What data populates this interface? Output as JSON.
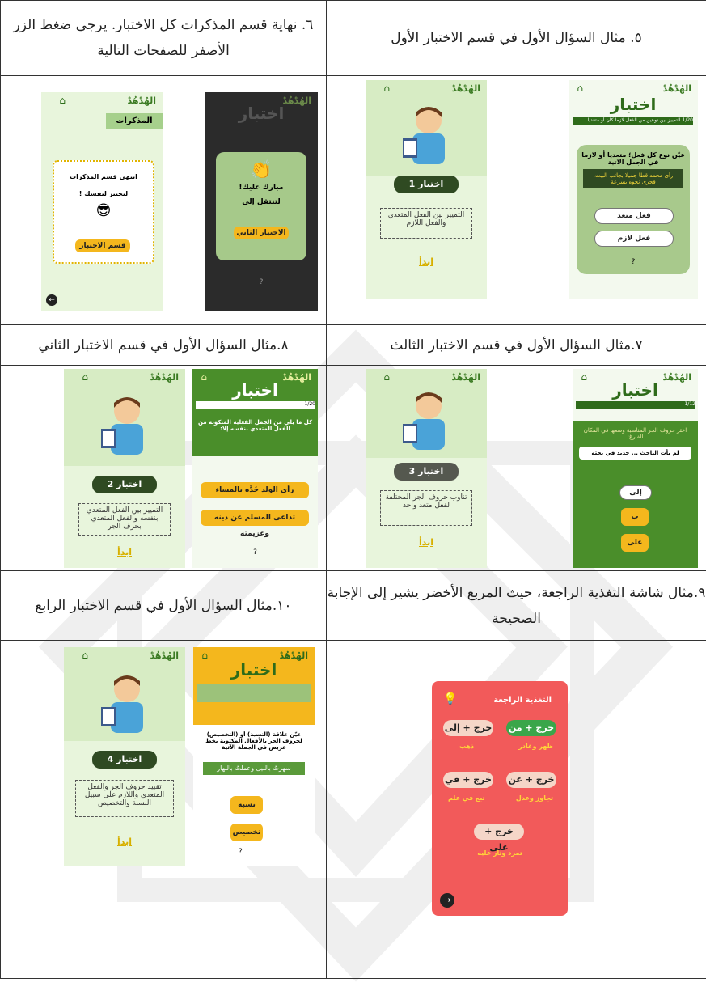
{
  "captions": {
    "c5": "٥. مثال السؤال الأول في قسم الاختبار الأول",
    "c6": "٦. نهاية قسم المذكرات كل الاختبار. يرجى ضغط الزر الأصفر للصفحات التالية",
    "c7": "٧.مثال السؤال الأول في قسم الاختبار الثالث",
    "c8": "٨.مثال السؤال الأول في قسم الاختبار الثاني",
    "c9": "٩.مثال شاشة التغذية الراجعة، حيث المربع الأخضر يشير إلى الإجابة الصحيحة",
    "c10": "١٠.مثال السؤال الأول في قسم الاختبار الرابع"
  },
  "app": {
    "brand": "الهُدْهُدْ",
    "quiz_title": "اختبار",
    "start": "ابدأ",
    "help": "?",
    "counter1": "1/20",
    "counter3": "1/12"
  },
  "s5": {
    "quiz_label": "اختبار 1",
    "desc": "التمييز بين الفعل المتعدي والفعل اللازم",
    "question_strip": "التمييز بين نوعين من الفعل لازما كان أو متعديا",
    "question": "عيّن نوع كل فعل؛ متعديا أو لازما في الجمل الآتية",
    "sentence": "رأى محمد قطا جميلا بجانب البيت، فجرى نحوه بسرعة",
    "opt1": "فعل متعد",
    "opt2": "فعل لازم"
  },
  "s6": {
    "notes_header": "المذكرات",
    "end_title": "انتهى قسم المذكرات",
    "end_sub": "لتختبر لنفسك !",
    "end_btn": "قسم الاختبار",
    "congrats": "مبارك عليك!",
    "go_to": "لتنتقل إلى",
    "next_btn": "الاختبار الثاني"
  },
  "s7": {
    "quiz_label": "اختبار 3",
    "desc": "تناوب حروف الجر المختلفة لفعل متعد واحد",
    "question": "اختر حروف الجر المناسبة وضعها في المكان الفارغ:",
    "sentence": "لم يأت الباحث ... جديد في بحثه",
    "opt_top": "إلى",
    "opt_a": "ب",
    "opt_b": "على"
  },
  "s8": {
    "quiz_label": "اختبار 2",
    "desc": "التمييز بين الفعل المتعدي بنفسه والفعل المتعدي بحرف الجر",
    "question": "كل ما يلي من الجمل الفعلية المتكونة من الفعل المتعدي بنفسه إلا:",
    "opt1": "رأى الولد خَدَّه بالمساء",
    "opt2": "تداعى المسلم عن دينه وعزيمته"
  },
  "s9": {
    "title": "التغذية الراجعة",
    "c1": "خرج + من",
    "c2": "خرج + إلى",
    "l1": "ظهر وغادر",
    "l2": "ذهب",
    "c3": "خرج + عن",
    "c4": "خرج + في",
    "l3": "تجاوز وعدل",
    "l4": "تبع في علم",
    "c5": "خرج + على",
    "l5": "تمرد وثار عليه"
  },
  "s10": {
    "quiz_label": "اختبار 4",
    "desc": "تقييد حروف الجر والفعل المتعدي واللازم على سبيل النسبة والتخصيص",
    "question": "عيّن علاقة (النسبة) أو (التخصيص) لحروف الجر بالأفعال المكتوبة بخط عريض في الجملة الآتية",
    "sentence": "سهرتُ بالليل وعملتُ بالنهار",
    "opt1": "نسبة",
    "opt2": "تخصيص"
  },
  "colors": {
    "green_dark": "#2e6b1a",
    "green_light": "#d7ecc4",
    "yellow": "#f4b71d",
    "feedback_red": "#f25a5a"
  }
}
